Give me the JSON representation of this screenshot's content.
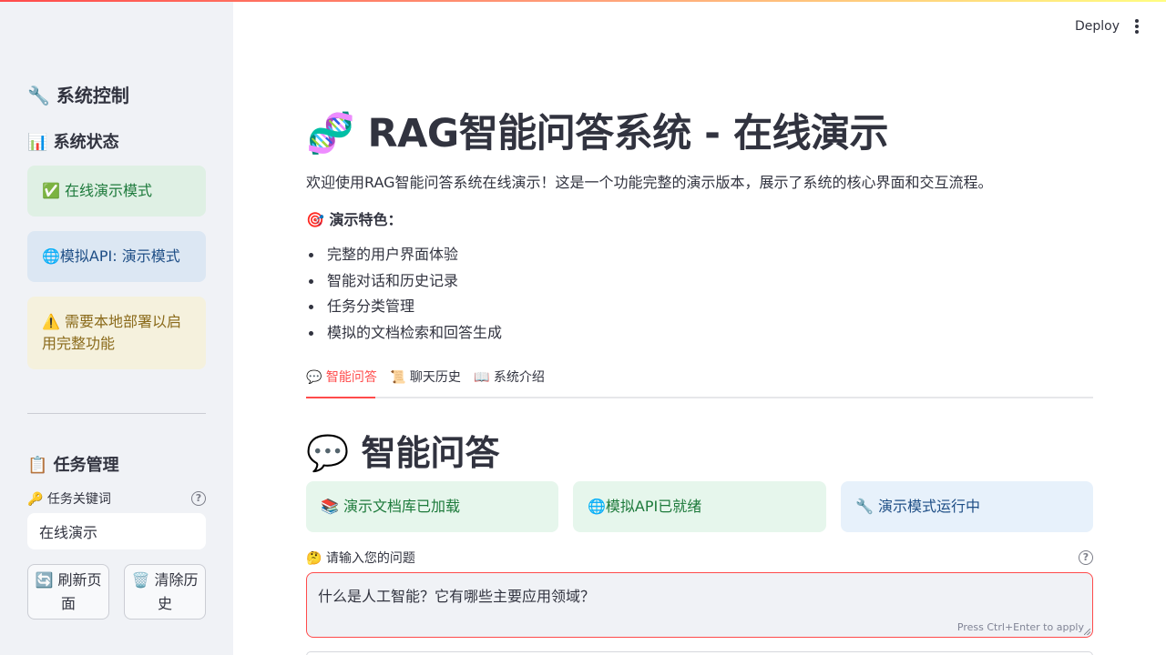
{
  "header": {
    "deploy_label": "Deploy",
    "menu_icon": "more-vertical-icon"
  },
  "sidebar": {
    "title": "🔧 系统控制",
    "status_title": "📊 系统状态",
    "status_items": [
      {
        "text": "✅ 在线演示模式",
        "kind": "success"
      },
      {
        "text": "🌐模拟API: 演示模式",
        "kind": "info"
      },
      {
        "text": "⚠️ 需要本地部署以启用完整功能",
        "kind": "warning"
      }
    ],
    "task_title": "📋 任务管理",
    "keyword_label": "🔑 任务关键词",
    "keyword_value": "在线演示",
    "refresh_label": "🔄 刷新页面",
    "clear_label": "🗑️ 清除历史"
  },
  "main": {
    "title": "🧬 RAG智能问答系统 - 在线演示",
    "intro": "欢迎使用RAG智能问答系统在线演示！这是一个功能完整的演示版本，展示了系统的核心界面和交互流程。",
    "features_heading": "🎯 演示特色：",
    "features": [
      "完整的用户界面体验",
      "智能对话和历史记录",
      "任务分类管理",
      "模拟的文档检索和回答生成"
    ],
    "tabs": [
      {
        "label": "💬 智能问答",
        "active": true
      },
      {
        "label": "📜 聊天历史",
        "active": false
      },
      {
        "label": "📖 系统介绍",
        "active": false
      }
    ],
    "section_title": "💬 智能问答",
    "status_cards": [
      {
        "text": "📚 演示文档库已加载",
        "color": "green"
      },
      {
        "text": "🌐模拟API已就绪",
        "color": "green"
      },
      {
        "text": "🔧 演示模式运行中",
        "color": "blue"
      }
    ],
    "question_label": "🤔 请输入您的问题",
    "question_value": "什么是人工智能？它有哪些主要应用领域？",
    "apply_hint": "Press Ctrl+Enter to apply"
  },
  "colors": {
    "accent": "#ff4b4b",
    "sidebar_bg": "#f0f2f6",
    "text": "#31333f"
  }
}
